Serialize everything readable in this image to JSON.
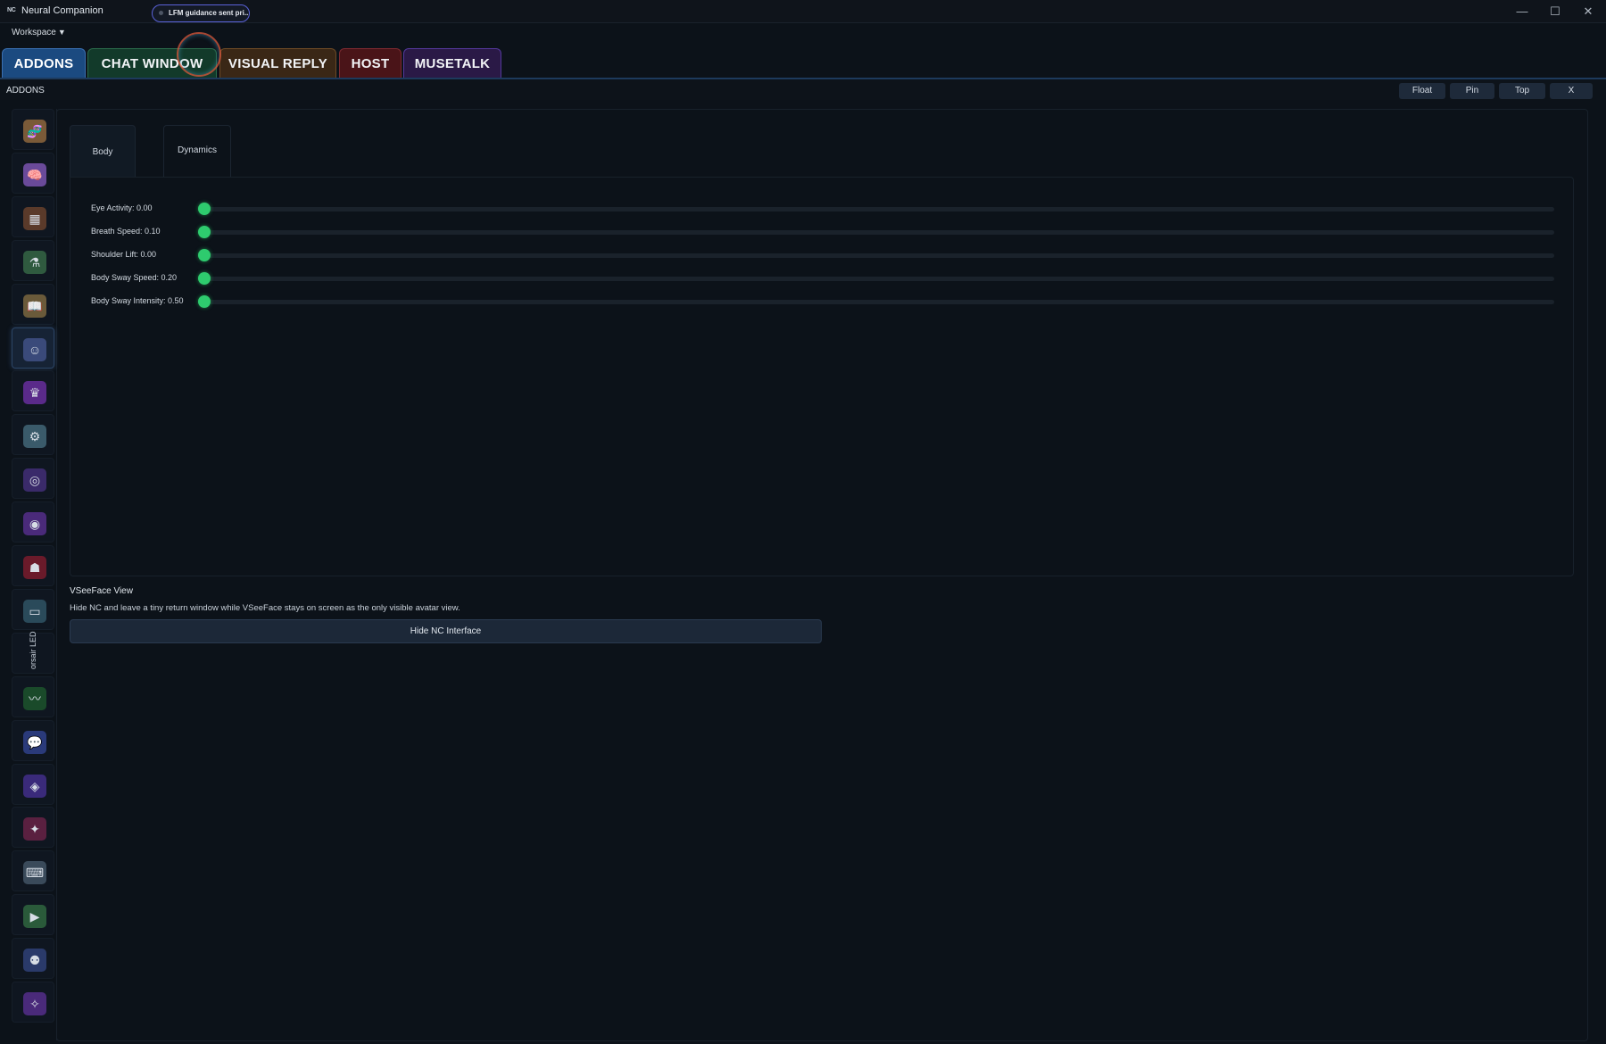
{
  "window": {
    "logo_text": "NC",
    "title": "Neural Companion",
    "status_pill": "LFM guidance sent pri...",
    "controls": {
      "minimize": "—",
      "maximize": "☐",
      "close": "✕"
    }
  },
  "menu": {
    "workspace": "Workspace",
    "caret": "▼"
  },
  "tabs": [
    {
      "label": "ADDONS",
      "active": true
    },
    {
      "label": "CHAT WINDOW"
    },
    {
      "label": "VISUAL REPLY"
    },
    {
      "label": "HOST"
    },
    {
      "label": "MUSETALK"
    }
  ],
  "section": {
    "title": "ADDONS",
    "buttons": {
      "float": "Float",
      "pin": "Pin",
      "top": "Top",
      "close": "X"
    }
  },
  "sidebar": {
    "items": [
      {
        "icon": "🧬",
        "name": "dna-addon-icon"
      },
      {
        "icon": "🧠",
        "name": "brain-addon-icon"
      },
      {
        "icon": "▦",
        "name": "grid-dashboard-icon"
      },
      {
        "icon": "⚗",
        "name": "flask-lab-icon"
      },
      {
        "icon": "📖",
        "name": "book-icon"
      },
      {
        "icon": "☺",
        "name": "avatar-face-icon"
      },
      {
        "icon": "♛",
        "name": "pose-figure-icon"
      },
      {
        "icon": "⚙",
        "name": "robot-settings-icon"
      },
      {
        "icon": "◎",
        "name": "target-orb-icon"
      },
      {
        "icon": "◉",
        "name": "purple-orb-icon"
      },
      {
        "icon": "☗",
        "name": "red-figure-icon"
      },
      {
        "icon": "▭",
        "name": "monitor-icon"
      },
      {
        "icon": "〰",
        "name": "waveform-icon"
      },
      {
        "icon": "💬",
        "name": "chat-bubbles-icon"
      },
      {
        "icon": "◈",
        "name": "discord-icon"
      },
      {
        "icon": "✦",
        "name": "spark-icon"
      },
      {
        "icon": "⌨",
        "name": "keyboard-icon"
      },
      {
        "icon": "▶",
        "name": "play-icon"
      },
      {
        "icon": "⚉",
        "name": "bot-icon"
      },
      {
        "icon": "✧",
        "name": "magic-icon"
      }
    ],
    "vertical_label": "orsair LED"
  },
  "subtabs": {
    "body": "Body",
    "dynamics": "Dynamics"
  },
  "sliders": [
    {
      "label": "Eye Activity: 0.00",
      "value": 0.0
    },
    {
      "label": "Breath Speed: 0.10",
      "value": 0.1
    },
    {
      "label": "Shoulder Lift: 0.00",
      "value": 0.0
    },
    {
      "label": "Body Sway Speed: 0.20",
      "value": 0.2
    },
    {
      "label": "Body Sway Intensity: 0.50",
      "value": 0.5
    }
  ],
  "vseeface": {
    "title": "VSeeFace View",
    "description": "Hide NC and leave a tiny return window while VSeeFace stays on screen as the only visible avatar view.",
    "button": "Hide NC Interface"
  },
  "colors": {
    "accent_green": "#2ecb6e",
    "tab_addons": "#1b4a80",
    "tab_chat": "#123a2a",
    "tab_visual": "#3a2716",
    "tab_host": "#4a1418",
    "tab_musetalk": "#2a1946"
  }
}
